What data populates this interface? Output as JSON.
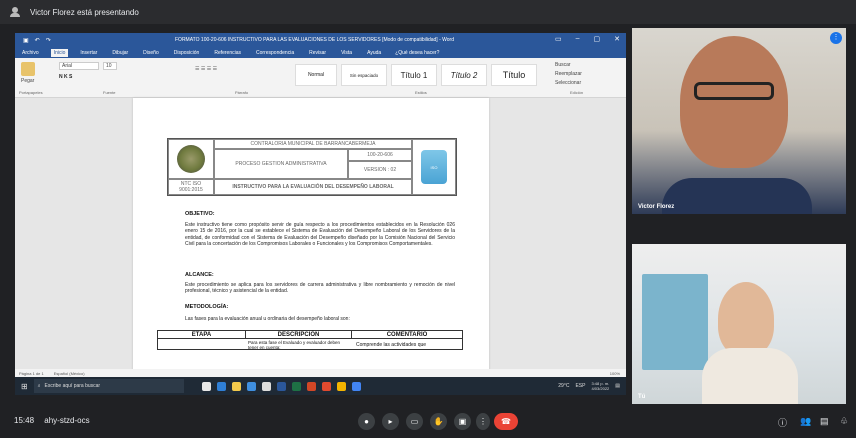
{
  "presenter_banner": "Victor Florez está presentando",
  "word": {
    "title": "FORMATO 100-20-606 INSTRUCTIVO PARA LAS EVALUACIONES DE LOS SERVIDORES [Modo de compatibilidad] - Word",
    "tabs": [
      "Archivo",
      "Inicio",
      "Insertar",
      "Dibujar",
      "Diseño",
      "Disposición",
      "Referencias",
      "Correspondencia",
      "Revisar",
      "Vista",
      "Ayuda"
    ],
    "tell_me": "¿Qué desea hacer?",
    "paste_label": "Pegar",
    "font_name": "Arial",
    "font_size": "10",
    "styles": [
      "Normal",
      "Sin espaciado",
      "Título 1",
      "Título 2",
      "Título"
    ],
    "edit_actions": [
      "Buscar",
      "Reemplazar",
      "Seleccionar"
    ],
    "group_labels": [
      "Portapapeles",
      "Fuente",
      "Párrafo",
      "Estilos",
      "Edición"
    ],
    "status_page": "Página 1 de 1",
    "status_lang": "Español (México)",
    "zoom": "100%"
  },
  "document": {
    "org": "CONTRALORIA MUNICIPAL DE BARRANCABERMEJA",
    "code": "100-20-606",
    "process": "PROCESO GESTION ADMINISTRATIVA",
    "version": "VERSION : 02",
    "ntc": "NTC ISO 9001:2015",
    "instructivo": "INSTRUCTIVO PARA LA EVALUACIÓN DEL DESEMPEÑO LABORAL",
    "objetivo_title": "OBJETIVO:",
    "objetivo_text": "Este instructivo tiene como propósito servir de guía respecto a los procedimientos establecidos en la Resolución 026 enero 15 de 2016, por la cual se establece el Sistema de Evaluación del Desempeño Laboral de los Servidores de la entidad, de conformidad con el Sistema de Evaluación del Desempeño diseñado por la Comisión Nacional del Servicio Civil para la concertación de los Compromisos Laborales o Funcionales y los Compromisos Comportamentales.",
    "alcance_title": "ALCANCE:",
    "alcance_text": "Este procedimiento se aplica para los servidores de carrera administrativa y libre nombramiento y remoción de nivel profesional, técnico y asistencial de la entidad.",
    "metodologia_title": "METODOLOGÍA:",
    "metodologia_text": "Las fases para la evaluación anual u ordinaria del desempeño laboral son:",
    "table_headers": [
      "ETAPA",
      "DESCRIPCIÓN",
      "COMENTARIO"
    ],
    "desc_row": "Para esta fase el Evaluado y evaluador deben tener en cuenta:",
    "comment_row": "Comprende las actividades que"
  },
  "taskbar": {
    "search_placeholder": "Escribe aquí para buscar",
    "weather": "29°C",
    "lang": "ESP",
    "time": "3:48 p. m.",
    "date": "4/03/2022"
  },
  "participants": {
    "main": "Victor Florez",
    "self": "Tú"
  },
  "meeting": {
    "time": "15:48",
    "code": "ahy-stzd-ocs"
  }
}
